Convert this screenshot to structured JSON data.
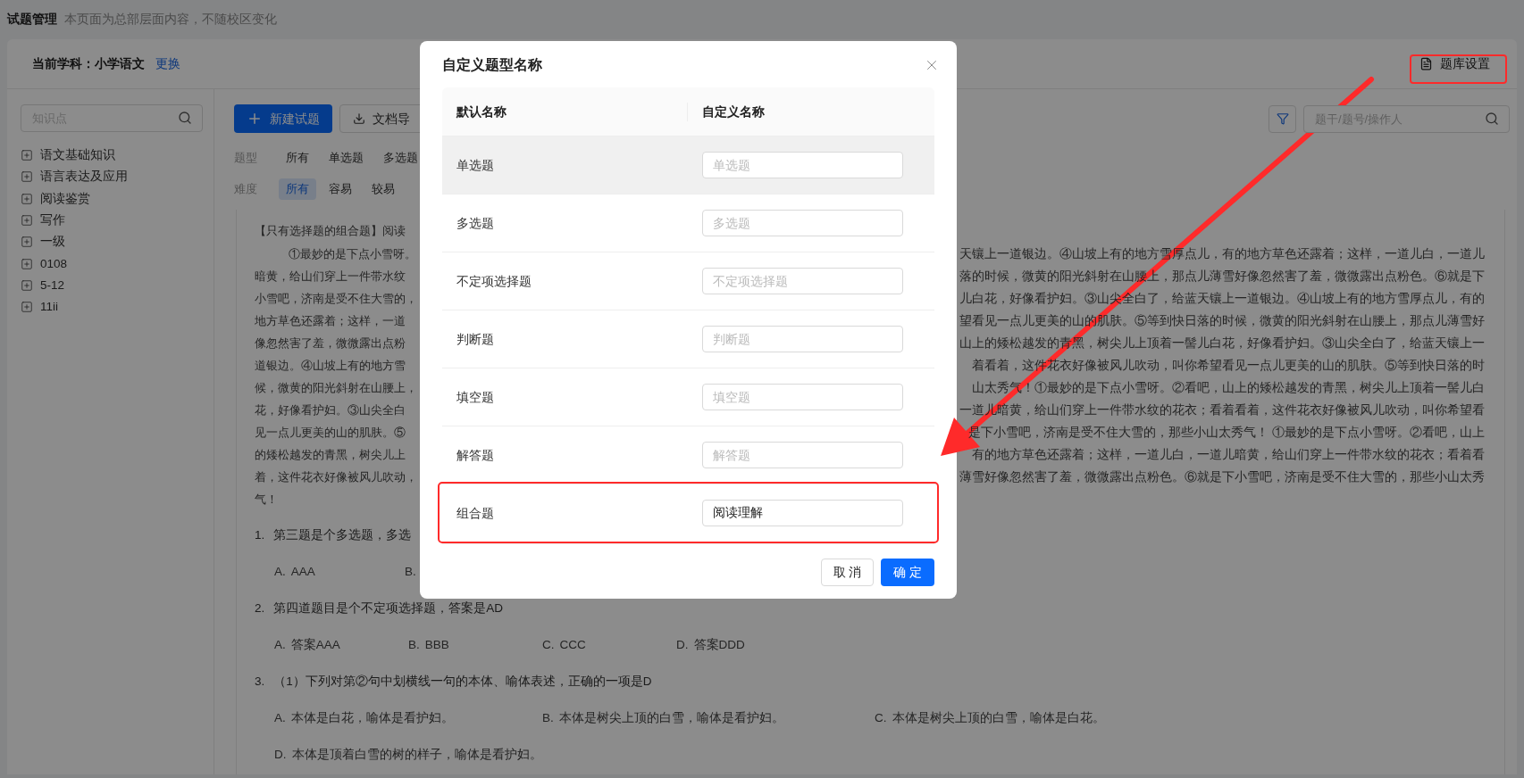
{
  "header": {
    "title": "试题管理",
    "note": "本页面为总部层面内容，不随校区变化"
  },
  "subject": {
    "label": "当前学科：小学语文",
    "change_link": "更换"
  },
  "settings_button": {
    "label": "题库设置",
    "marked": true
  },
  "sidebar": {
    "search": {
      "placeholder": "知识点"
    },
    "tree": [
      {
        "label": "语文基础知识",
        "expanded": false
      },
      {
        "label": "语言表达及应用",
        "expanded": false
      },
      {
        "label": "阅读鉴赏",
        "expanded": false
      },
      {
        "label": "写作",
        "expanded": false
      },
      {
        "label": "一级",
        "expanded": false
      },
      {
        "label": "0108",
        "expanded": false
      },
      {
        "label": "5-12",
        "expanded": false
      },
      {
        "label": "11ii",
        "expanded": false
      }
    ]
  },
  "toolbar": {
    "new_button": "新建试题",
    "import_button": "文档导",
    "search": {
      "placeholder": "题干/题号/操作人"
    }
  },
  "filters": [
    {
      "label": "题型",
      "options": [
        {
          "label": "所有",
          "selected": false
        },
        {
          "label": "单选题",
          "selected": false
        },
        {
          "label": "多选题",
          "selected": false
        }
      ]
    },
    {
      "label": "难度",
      "options": [
        {
          "label": "所有",
          "selected": true
        },
        {
          "label": "容易",
          "selected": false
        },
        {
          "label": "较易",
          "selected": false
        }
      ]
    }
  ],
  "passage": {
    "lines": [
      {
        "left": "【只有选择题的组合题】阅读",
        "indent": false
      },
      {
        "left": "①最妙的是下点小雪呀。",
        "right": "天镶上一道银边。④山坡上有的地方雪厚点儿，有的地方草色还露着；这样，一道儿白，一道儿",
        "indent": true
      },
      {
        "left": "暗黄，给山们穿上一件带水纹",
        "right": "落的时候，微黄的阳光斜射在山腰上，那点儿薄雪好像忽然害了羞，微微露出点粉色。⑥就是下",
        "indent": false
      },
      {
        "left": "小雪吧，济南是受不住大雪的，",
        "right": "儿白花，好像看护妇。③山尖全白了，给蓝天镶上一道银边。④山坡上有的地方雪厚点儿，有的",
        "indent": false
      },
      {
        "left": "地方草色还露着；这样，一道",
        "right": "望看见一点儿更美的山的肌肤。⑤等到快日落的时候，微黄的阳光斜射在山腰上，那点儿薄雪好",
        "indent": false
      },
      {
        "left": "像忽然害了羞，微微露出点粉",
        "right": "山上的矮松越发的青黑，树尖儿上顶着一髻儿白花，好像看护妇。③山尖全白了，给蓝天镶上一",
        "indent": false
      },
      {
        "left": "道银边。④山坡上有的地方雪",
        "right": "着看着，这件花衣好像被风儿吹动，叫你希望看见一点儿更美的山的肌肤。⑤等到快日落的时",
        "indent": false
      },
      {
        "left": "候，微黄的阳光斜射在山腰上，",
        "right": "山太秀气！①最妙的是下点小雪呀。②看吧，山上的矮松越发的青黑，树尖儿上顶着一髻儿白",
        "indent": false
      },
      {
        "left": "花，好像看护妇。③山尖全白",
        "right": "一道儿暗黄，给山们穿上一件带水纹的花衣；看着看着，这件花衣好像被风儿吹动，叫你希望看",
        "indent": false
      },
      {
        "left": "见一点儿更美的山的肌肤。⑤",
        "right": "是下小雪吧，济南是受不住大雪的，那些小山太秀气！ ①最妙的是下点小雪呀。②看吧，山上",
        "indent": false
      },
      {
        "left": "的矮松越发的青黑，树尖儿上",
        "right": "有的地方草色还露着；这样，一道儿白，一道儿暗黄，给山们穿上一件带水纹的花衣；看着看",
        "indent": false
      },
      {
        "left": "着，这件花衣好像被风儿吹动，",
        "right": "薄雪好像忽然害了羞，微微露出点粉色。⑥就是下小雪吧，济南是受不住大雪的，那些小山太秀",
        "indent": false
      },
      {
        "left": "气！",
        "indent": false
      }
    ]
  },
  "questions": [
    {
      "number": "1.",
      "stem": "第三题是个多选题，多选",
      "option_rows": [
        [
          {
            "letter": "A.",
            "text": "AAA"
          },
          {
            "letter": "B."
          }
        ]
      ]
    },
    {
      "number": "2.",
      "stem": "第四道题目是个不定项选择题，答案是AD",
      "option_rows": [
        [
          {
            "letter": "A.",
            "text": "答案AAA"
          },
          {
            "letter": "B.",
            "text": "BBB"
          },
          {
            "letter": "C.",
            "text": "CCC"
          },
          {
            "letter": "D.",
            "text": "答案DDD"
          }
        ]
      ]
    },
    {
      "number": "3.",
      "stem": "（1）下列对第②句中划横线一句的本体、喻体表述，正确的一项是D",
      "option_rows": [
        [
          {
            "letter": "A.",
            "text": "本体是白花，喻体是看护妇。"
          },
          {
            "letter": "B.",
            "text": "本体是树尖上顶的白雪，喻体是看护妇。"
          },
          {
            "letter": "C.",
            "text": "本体是树尖上顶的白雪，喻体是白花。"
          }
        ],
        [
          {
            "letter": "D.",
            "text": "本体是顶着白雪的树的样子，喻体是看护妇。"
          }
        ]
      ]
    }
  ],
  "dialog": {
    "title": "自定义题型名称",
    "columns": [
      "默认名称",
      "自定义名称"
    ],
    "rows": [
      {
        "default_name": "单选题",
        "placeholder": "单选题",
        "highlighted": true,
        "marked": false
      },
      {
        "default_name": "多选题",
        "placeholder": "多选题",
        "highlighted": false,
        "marked": false
      },
      {
        "default_name": "不定项选择题",
        "placeholder": "不定项选择题",
        "highlighted": false,
        "marked": false
      },
      {
        "default_name": "判断题",
        "placeholder": "判断题",
        "highlighted": false,
        "marked": false
      },
      {
        "default_name": "填空题",
        "placeholder": "填空题",
        "highlighted": false,
        "marked": false
      },
      {
        "default_name": "解答题",
        "placeholder": "解答题",
        "highlighted": false,
        "marked": false
      },
      {
        "default_name": "组合题",
        "value": "阅读理解",
        "highlighted": false,
        "marked": true
      }
    ],
    "buttons": [
      {
        "label": "取 消",
        "kind": "default"
      },
      {
        "label": "确 定",
        "kind": "primary"
      }
    ]
  }
}
